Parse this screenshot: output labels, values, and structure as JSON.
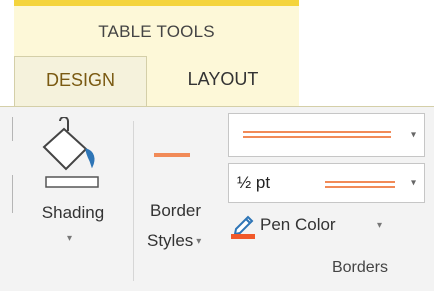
{
  "contextual_tab": {
    "title": "TABLE TOOLS"
  },
  "tabs": [
    {
      "label": "DESIGN",
      "active": true
    },
    {
      "label": "LAYOUT",
      "active": false
    }
  ],
  "ribbon": {
    "shading": {
      "label": "Shading",
      "icon": "paint-bucket-icon"
    },
    "border_styles": {
      "line1": "Border",
      "line2": "Styles"
    },
    "line_weight": {
      "value": "½ pt"
    },
    "pen_color": {
      "label": "Pen Color",
      "icon": "pen-icon",
      "color": "#f1592a"
    },
    "group_label": "Borders"
  },
  "colors": {
    "accent": "#f18a57",
    "context_band": "#fdf8d8",
    "context_line": "#f4d43d"
  }
}
